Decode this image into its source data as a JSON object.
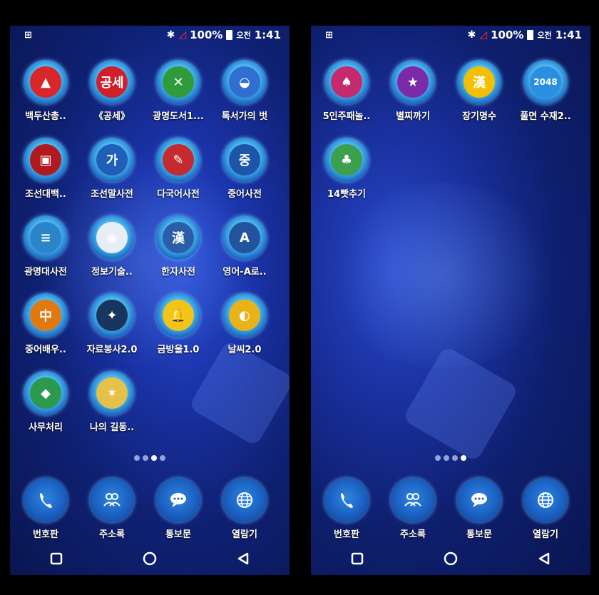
{
  "status_bar": {
    "left_icon": "qr-grid-icon",
    "bluetooth_icon": "bluetooth-icon",
    "signal_icon": "signal-icon",
    "battery_text": "100%",
    "battery_icon": "battery-icon",
    "ampm": "오전",
    "time": "1:41"
  },
  "screen_left": {
    "apps": [
      {
        "label": "백두산총..",
        "color": "#d8262b",
        "glyph": "▲"
      },
      {
        "label": "《공세》",
        "color": "#d01e2a",
        "glyph": "공세"
      },
      {
        "label": "광명도서1...",
        "color": "#2f9b3a",
        "glyph": "✕"
      },
      {
        "label": "톡서가의 벗",
        "color": "#2f6fd0",
        "glyph": "◒"
      },
      {
        "label": "조선대백..",
        "color": "#b01a1f",
        "glyph": "▣"
      },
      {
        "label": "조선말사전",
        "color": "#1f5fb8",
        "glyph": "가"
      },
      {
        "label": "다국어사전",
        "color": "#c42a2e",
        "glyph": "✎"
      },
      {
        "label": "중어사전",
        "color": "#1d56a8",
        "glyph": "중"
      },
      {
        "label": "광명대사전",
        "color": "#2a86c8",
        "glyph": "≡"
      },
      {
        "label": "정보기술..",
        "color": "#e8eef5",
        "glyph": "◉"
      },
      {
        "label": "한자사전",
        "color": "#2a5ea8",
        "glyph": "漢"
      },
      {
        "label": "영어-A로..",
        "color": "#24539e",
        "glyph": "A"
      },
      {
        "label": "중어배우..",
        "color": "#e07a10",
        "glyph": "中"
      },
      {
        "label": "자료봉사2.0",
        "color": "#17355e",
        "glyph": "✦"
      },
      {
        "label": "금방울1.0",
        "color": "#f2c418",
        "glyph": "🔔"
      },
      {
        "label": "날씨2.0",
        "color": "#e9b318",
        "glyph": "◐"
      },
      {
        "label": "사무처리",
        "color": "#2c9a4c",
        "glyph": "◆"
      },
      {
        "label": "나의 길동..",
        "color": "#e6c14a",
        "glyph": "✶"
      }
    ],
    "page_dots": 4,
    "active_dot": 3
  },
  "screen_right": {
    "apps": [
      {
        "label": "5인주패놀..",
        "color": "#c52a6f",
        "glyph": "♠"
      },
      {
        "label": "별찌까기",
        "color": "#7b2aa8",
        "glyph": "★"
      },
      {
        "label": "장기명수",
        "color": "#f2c000",
        "glyph": "漢"
      },
      {
        "label": "풀면 수재2..",
        "color": "#2a8fe0",
        "glyph": "2048"
      },
      {
        "label": "14빳추기",
        "color": "#3aa04c",
        "glyph": "♣"
      }
    ],
    "page_dots": 4,
    "active_dot": 4
  },
  "dock": [
    {
      "label": "번호판",
      "icon": "phone-icon"
    },
    {
      "label": "주소록",
      "icon": "contacts-icon"
    },
    {
      "label": "통보문",
      "icon": "message-icon"
    },
    {
      "label": "열람기",
      "icon": "globe-icon"
    }
  ],
  "nav": {
    "recent": "recent-apps-icon",
    "home": "home-icon",
    "back": "back-icon"
  }
}
